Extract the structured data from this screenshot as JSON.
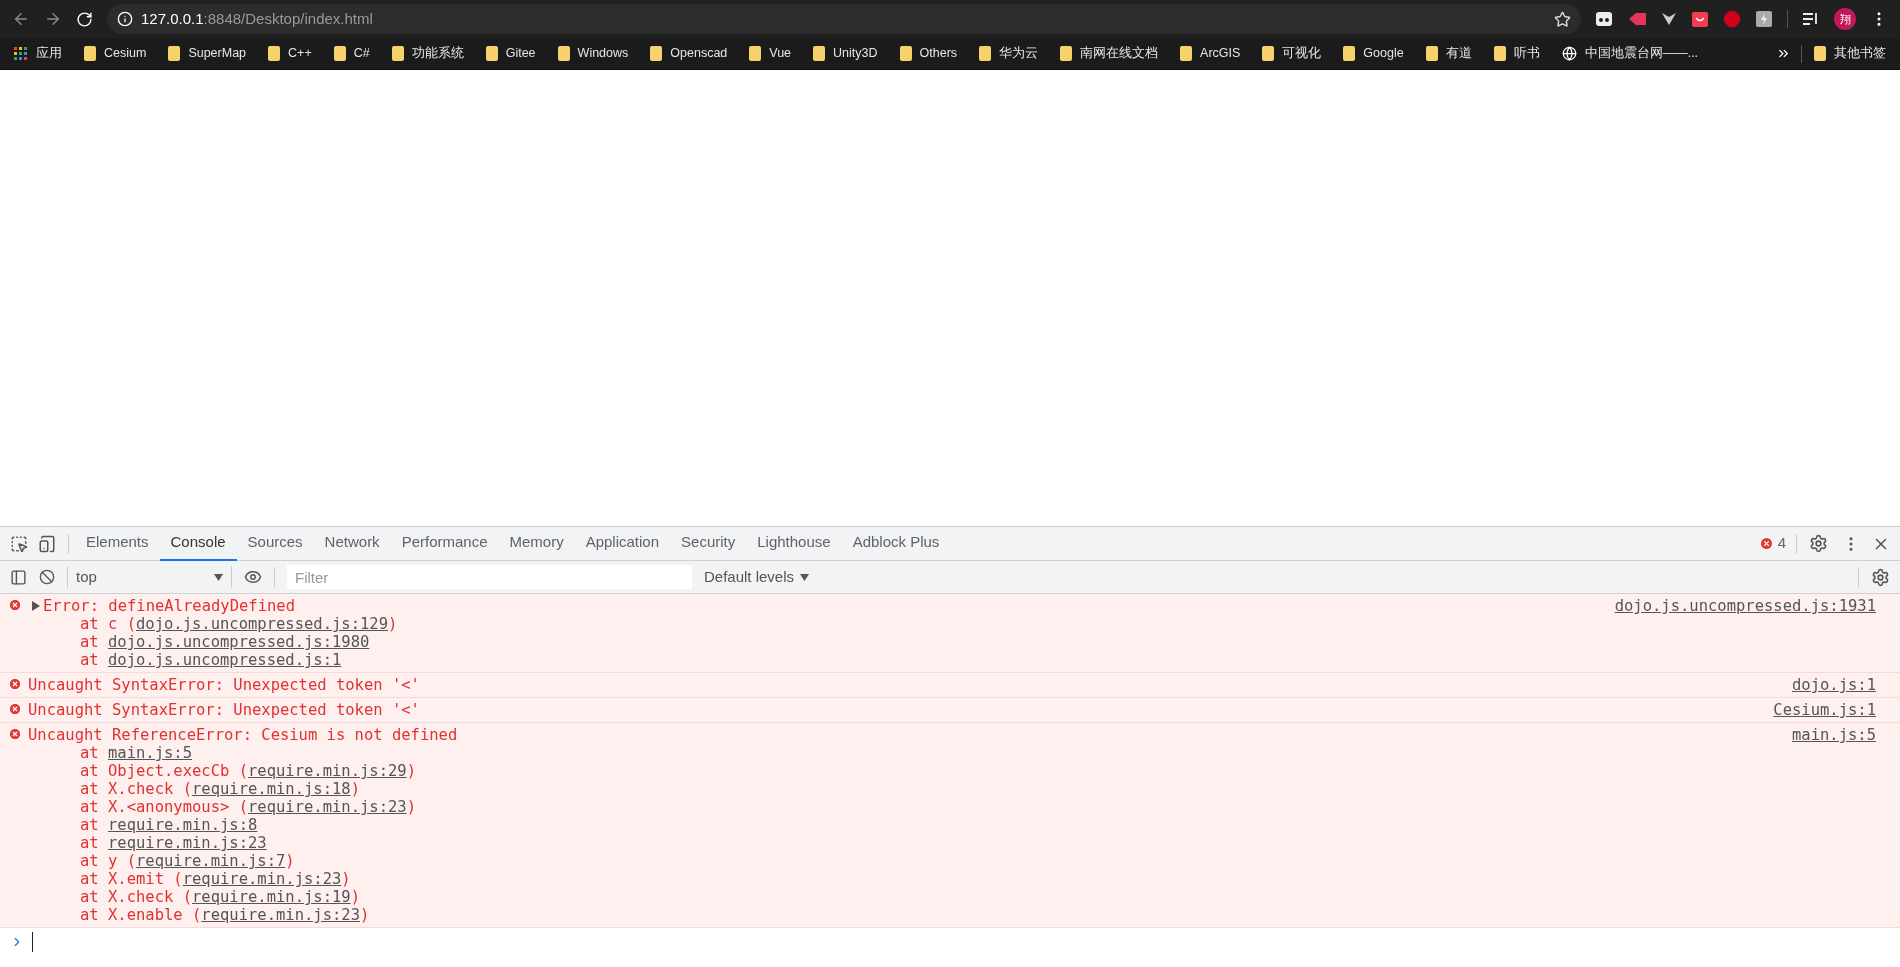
{
  "browser": {
    "address": {
      "host": "127.0.0.1",
      "path": ":8848/Desktop/index.html"
    },
    "avatar_letter": "翔"
  },
  "bookmarks": [
    {
      "kind": "apps",
      "label": "应用"
    },
    {
      "kind": "folder",
      "label": "Cesium"
    },
    {
      "kind": "folder",
      "label": "SuperMap"
    },
    {
      "kind": "folder",
      "label": "C++"
    },
    {
      "kind": "folder",
      "label": "C#"
    },
    {
      "kind": "folder",
      "label": "功能系统"
    },
    {
      "kind": "folder",
      "label": "Gitee"
    },
    {
      "kind": "folder",
      "label": "Windows"
    },
    {
      "kind": "folder",
      "label": "Openscad"
    },
    {
      "kind": "folder",
      "label": "Vue"
    },
    {
      "kind": "folder",
      "label": "Unity3D"
    },
    {
      "kind": "folder",
      "label": "Others"
    },
    {
      "kind": "folder",
      "label": "华为云"
    },
    {
      "kind": "folder",
      "label": "南网在线文档"
    },
    {
      "kind": "folder",
      "label": "ArcGIS"
    },
    {
      "kind": "folder",
      "label": "可视化"
    },
    {
      "kind": "folder",
      "label": "Google"
    },
    {
      "kind": "folder",
      "label": "有道"
    },
    {
      "kind": "folder",
      "label": "听书"
    },
    {
      "kind": "site",
      "label": "中国地震台网——..."
    }
  ],
  "other_bookmarks": "其他书签",
  "devtools": {
    "tabs": [
      {
        "label": "Elements",
        "selected": false
      },
      {
        "label": "Console",
        "selected": true
      },
      {
        "label": "Sources",
        "selected": false
      },
      {
        "label": "Network",
        "selected": false
      },
      {
        "label": "Performance",
        "selected": false
      },
      {
        "label": "Memory",
        "selected": false
      },
      {
        "label": "Application",
        "selected": false
      },
      {
        "label": "Security",
        "selected": false
      },
      {
        "label": "Lighthouse",
        "selected": false
      },
      {
        "label": "Adblock Plus",
        "selected": false
      }
    ],
    "error_count": "4",
    "context": "top",
    "filter_placeholder": "Filter",
    "levels": "Default levels",
    "messages": [
      {
        "text": "Error: defineAlreadyDefined",
        "expanded": false,
        "source": "dojo.js.uncompressed.js:1931",
        "frames": [
          {
            "before": "at c (",
            "link": "dojo.js.uncompressed.js:129",
            "after": ")"
          },
          {
            "before": "at ",
            "link": "dojo.js.uncompressed.js:1980"
          },
          {
            "before": "at ",
            "link": "dojo.js.uncompressed.js:1"
          }
        ]
      },
      {
        "text": "Uncaught SyntaxError: Unexpected token '<'",
        "source": "dojo.js:1"
      },
      {
        "text": "Uncaught SyntaxError: Unexpected token '<'",
        "source": "Cesium.js:1"
      },
      {
        "text": "Uncaught ReferenceError: Cesium is not defined",
        "source": "main.js:5",
        "frames": [
          {
            "before": "at ",
            "link": "main.js:5"
          },
          {
            "before": "at Object.execCb (",
            "link": "require.min.js:29",
            "after": ")"
          },
          {
            "before": "at X.check (",
            "link": "require.min.js:18",
            "after": ")"
          },
          {
            "before": "at X.<anonymous> (",
            "link": "require.min.js:23",
            "after": ")"
          },
          {
            "before": "at ",
            "link": "require.min.js:8"
          },
          {
            "before": "at ",
            "link": "require.min.js:23"
          },
          {
            "before": "at y (",
            "link": "require.min.js:7",
            "after": ")"
          },
          {
            "before": "at X.emit (",
            "link": "require.min.js:23",
            "after": ")"
          },
          {
            "before": "at X.check (",
            "link": "require.min.js:19",
            "after": ")"
          },
          {
            "before": "at X.enable (",
            "link": "require.min.js:23",
            "after": ")"
          }
        ]
      }
    ]
  }
}
